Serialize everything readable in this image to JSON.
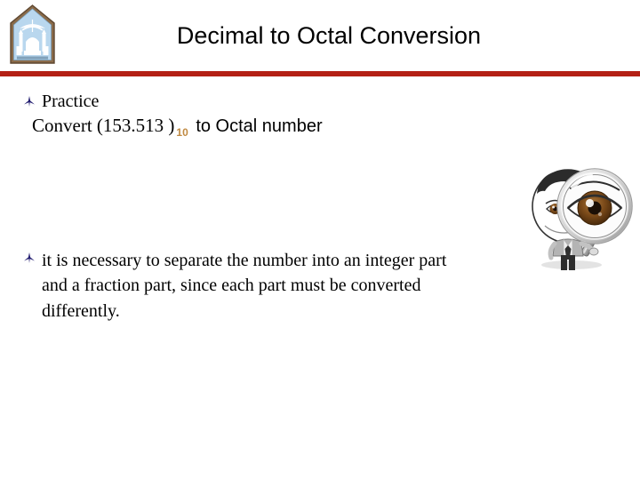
{
  "slide": {
    "title": "Decimal to Octal Conversion",
    "divider_color": "#b42015",
    "background_color": "#ffffff"
  },
  "logo": {
    "name": "university-shield-emblem",
    "shape": "pentagon-shield",
    "border_color": "#8a6b4a",
    "field_color": "#b9d7ee",
    "caption": ""
  },
  "bullets": [
    {
      "marker": "arrow-bullet-icon",
      "marker_color": "#1f1a6e",
      "label": "Practice"
    },
    {
      "marker": "arrow-bullet-icon",
      "marker_color": "#1f1a6e",
      "label": "it is necessary to separate the number into an integer part and a fraction part, since each part must be converted differently."
    }
  ],
  "convert_line": {
    "prefix": "Convert  (153.513 )",
    "subscript": "10",
    "subscript_color": "#c08a42",
    "suffix": " to Octal number"
  },
  "clipart": {
    "name": "man-with-magnifying-glass",
    "description": "person holding a magnifying glass enlarging one eye",
    "eye_color": "#6b3f16",
    "hair_color": "#2b2b2b",
    "suit_color": "#9a9a9a"
  }
}
